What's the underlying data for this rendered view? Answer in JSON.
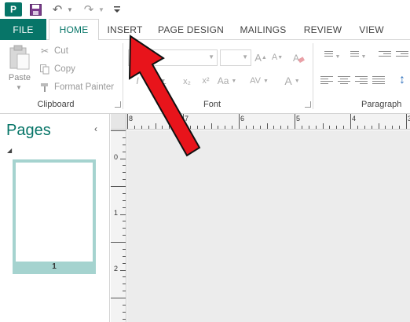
{
  "app": {
    "icon_label": "P"
  },
  "qat": {
    "icons": [
      "publisher-app-icon",
      "save-icon",
      "undo-icon",
      "redo-icon",
      "customize-qat-icon"
    ]
  },
  "tabs": [
    {
      "label": "FILE"
    },
    {
      "label": "HOME"
    },
    {
      "label": "INSERT"
    },
    {
      "label": "PAGE DESIGN"
    },
    {
      "label": "MAILINGS"
    },
    {
      "label": "REVIEW"
    },
    {
      "label": "VIEW"
    }
  ],
  "clipboard": {
    "paste_label": "Paste",
    "cut_label": "Cut",
    "copy_label": "Copy",
    "format_painter_label": "Format Painter",
    "group_label": "Clipboard"
  },
  "font": {
    "grow_label": "A",
    "shrink_label": "A",
    "italic_label": "I",
    "underline_label": "U",
    "subscript_label": "x₂",
    "superscript_label": "x²",
    "change_case_label": "Aa",
    "spacing_label": "AV",
    "color_label": "A",
    "group_label": "Font"
  },
  "paragraph": {
    "group_label": "Paragraph"
  },
  "pages_pane": {
    "title": "Pages",
    "collapse_glyph": "‹",
    "thumbnail_number": "1"
  },
  "ruler": {
    "horizontal_numbers": [
      "8",
      "7",
      "6",
      "5",
      "4",
      "3"
    ],
    "vertical_numbers": [
      "0",
      "1",
      "2"
    ]
  },
  "colors": {
    "accent": "#077568",
    "annotation_arrow": "#e8141b",
    "thumbnail_frame": "#a5d3cf"
  }
}
